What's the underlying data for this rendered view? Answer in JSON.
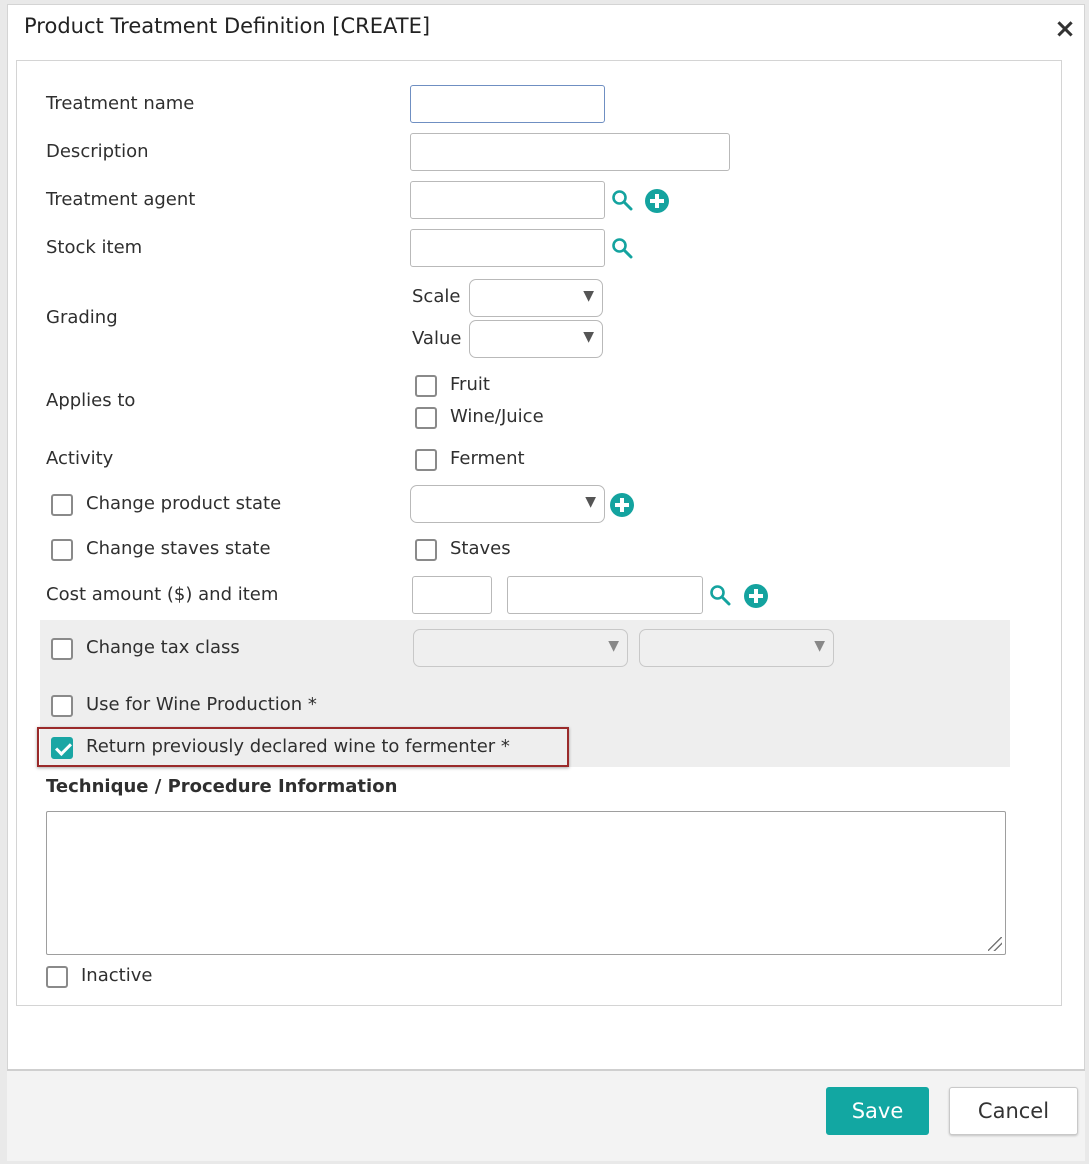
{
  "dialog": {
    "title": "Product Treatment Definition [CREATE]",
    "close_icon": "close-icon"
  },
  "form": {
    "treatment_name": {
      "label": "Treatment name",
      "value": ""
    },
    "description": {
      "label": "Description",
      "value": ""
    },
    "treatment_agent": {
      "label": "Treatment agent",
      "value": "",
      "icons": [
        "search-icon",
        "add-icon"
      ]
    },
    "stock_item": {
      "label": "Stock item",
      "value": "",
      "icons": [
        "search-icon"
      ]
    },
    "grading": {
      "label": "Grading",
      "scale": {
        "label": "Scale",
        "value": ""
      },
      "value": {
        "label": "Value",
        "value": ""
      }
    },
    "applies_to": {
      "label": "Applies to",
      "options": [
        {
          "label": "Fruit",
          "checked": false
        },
        {
          "label": "Wine/Juice",
          "checked": false
        }
      ]
    },
    "activity": {
      "label": "Activity",
      "options": [
        {
          "label": "Ferment",
          "checked": false
        }
      ]
    },
    "change_product_state": {
      "label": "Change product state",
      "checked": false,
      "select_value": ""
    },
    "change_staves_state": {
      "label": "Change staves state",
      "checked": false,
      "staves_label": "Staves",
      "staves_checked": false
    },
    "cost_amount": {
      "label": "Cost amount ($) and item",
      "amount": "",
      "item": ""
    },
    "change_tax_class": {
      "label": "Change tax class",
      "checked": false,
      "select1": "",
      "select2": ""
    },
    "use_for_wine_production": {
      "label": "Use for Wine Production *",
      "checked": false
    },
    "return_to_fermenter": {
      "label": "Return previously declared wine to fermenter *",
      "checked": true
    },
    "technique": {
      "label": "Technique / Procedure Information",
      "value": ""
    },
    "inactive": {
      "label": "Inactive",
      "checked": false
    }
  },
  "footer": {
    "save_label": "Save",
    "cancel_label": "Cancel"
  },
  "colors": {
    "accent": "#12a7a2",
    "highlight_border": "#9a2a2a"
  }
}
